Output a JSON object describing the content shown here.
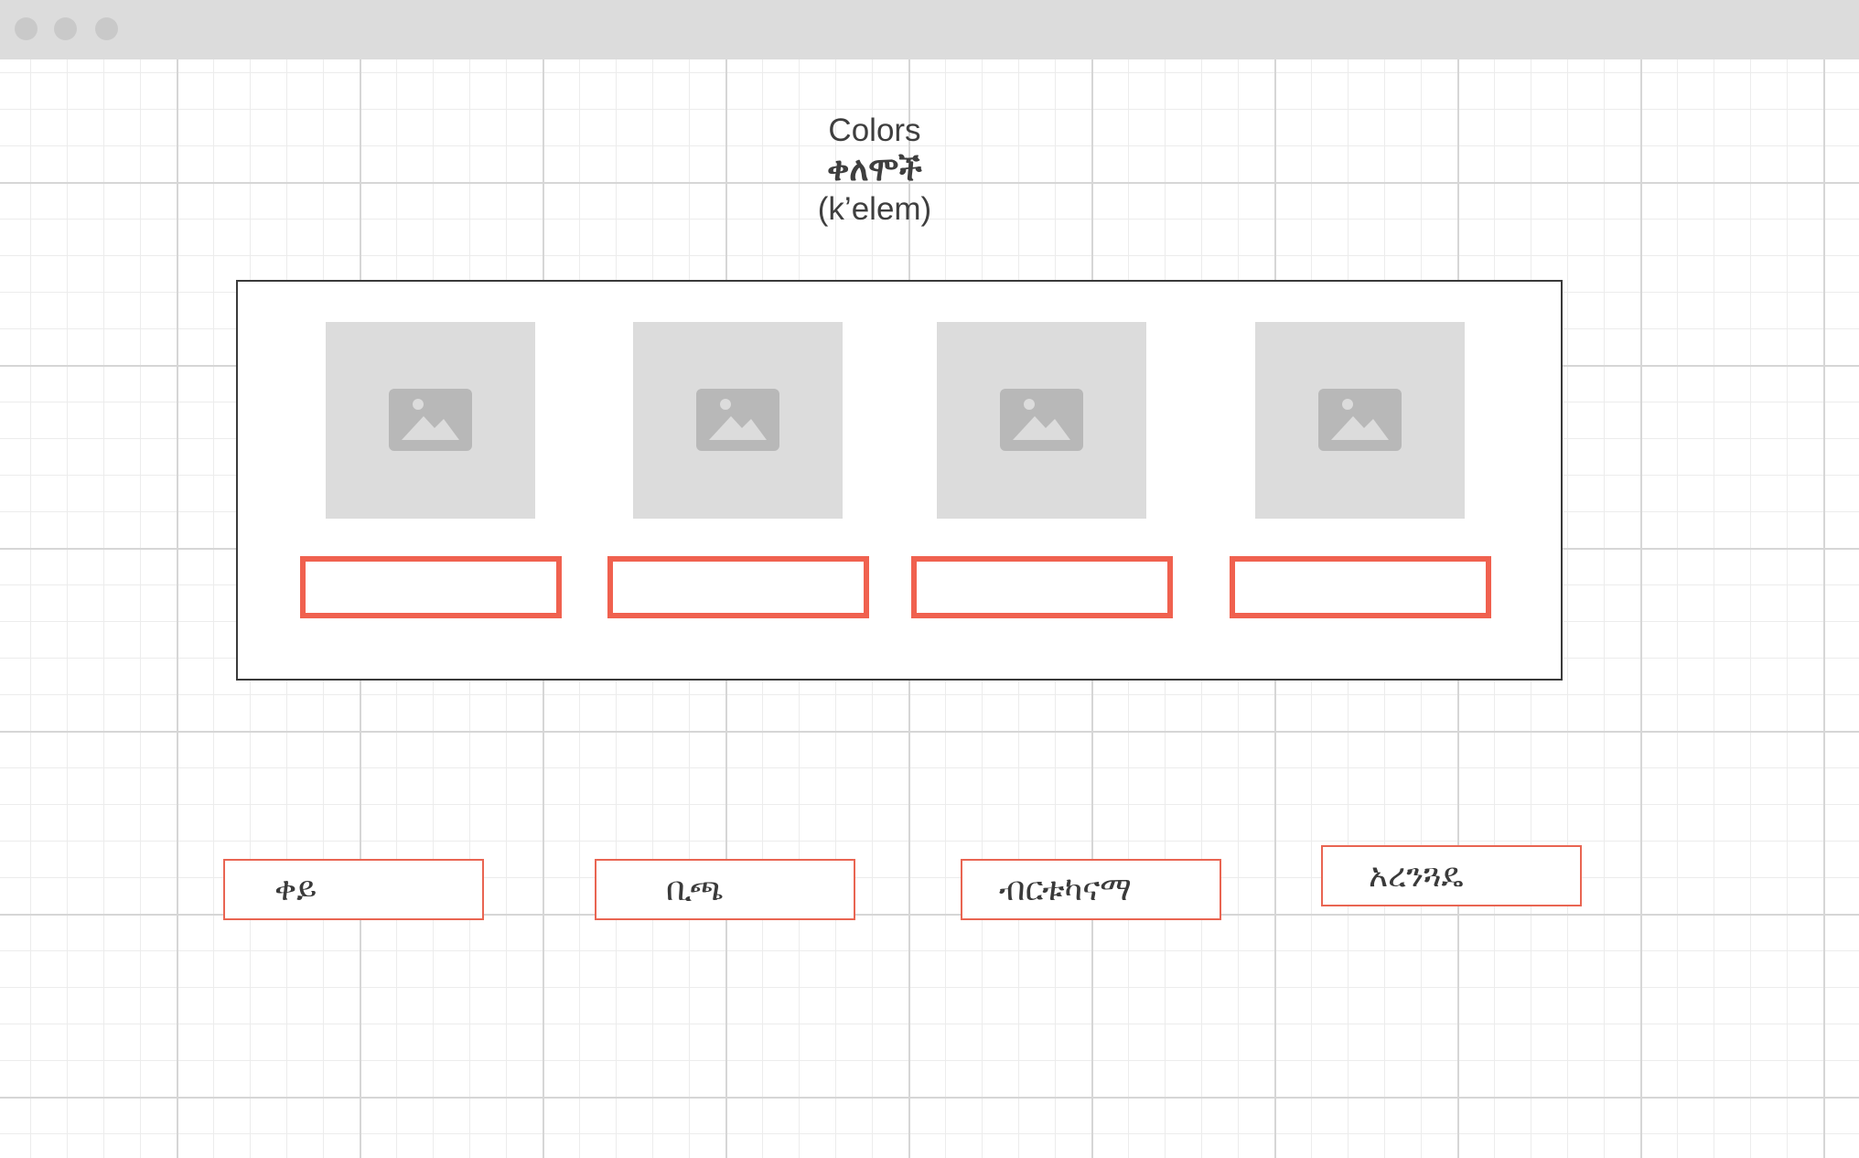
{
  "window": {
    "controls": [
      "close",
      "minimize",
      "maximize"
    ]
  },
  "header": {
    "title_en": "Colors",
    "title_am": "ቀለሞች",
    "transliteration": "(k’elem)"
  },
  "matching": {
    "images": [
      {
        "icon": "image-placeholder-icon"
      },
      {
        "icon": "image-placeholder-icon"
      },
      {
        "icon": "image-placeholder-icon"
      },
      {
        "icon": "image-placeholder-icon"
      }
    ],
    "answer_boxes": [
      "",
      "",
      "",
      ""
    ]
  },
  "word_bank": [
    {
      "label": "ቀይ"
    },
    {
      "label": "ቢጫ"
    },
    {
      "label": "ብርቱካናማ"
    },
    {
      "label": "አረንጓዴ"
    }
  ],
  "colors": {
    "accent": "#f0614f",
    "placeholder": "#dcdcdc",
    "placeholder_icon": "#b8b8b8",
    "text": "#3e3e3e"
  }
}
